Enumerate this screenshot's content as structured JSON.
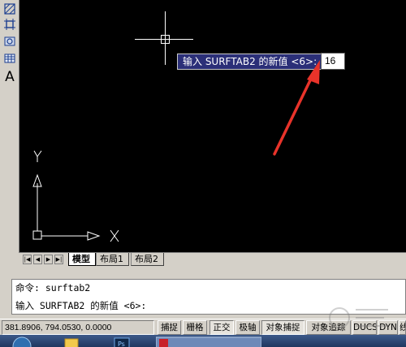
{
  "toolbar": {
    "icons": [
      "hatch-icon",
      "region-icon",
      "boundary-icon",
      "table-icon",
      "text-icon"
    ],
    "text_tool_label": "A"
  },
  "drawing": {
    "dynamic_prompt": "输入 SURFTAB2 的新值 <6>:",
    "dynamic_input_value": "16",
    "ucs_x_label": "X",
    "ucs_y_label": "Y",
    "background_color": "#000000",
    "arrow_color": "#e8332a"
  },
  "tabs": {
    "model": "模型",
    "layout1": "布局1",
    "layout2": "布局2"
  },
  "command": {
    "history_line": "命令: surftab2",
    "current_line": "输入 SURFTAB2 的新值 <6>:"
  },
  "status": {
    "coordinates": "381.8906, 794.0530, 0.0000",
    "snap": "捕捉",
    "grid": "栅格",
    "ortho": "正交",
    "polar": "极轴",
    "osnap": "对象捕捉",
    "otrack": "对象追踪",
    "ducs": "DUCS",
    "dyn": "DYN",
    "lwt": "线"
  },
  "taskbar": {
    "items": [
      "start-button-icon",
      "explorer-icon",
      "photoshop-icon",
      "autocad-task-icon"
    ]
  }
}
